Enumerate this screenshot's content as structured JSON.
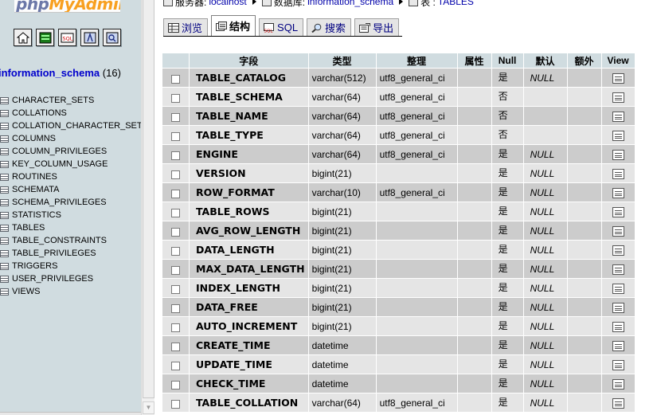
{
  "nav": {
    "logo_part1": "php",
    "logo_part2": "MyAdmin",
    "icons": [
      "home-icon",
      "sql-window-icon",
      "sql-query-icon",
      "help-icon",
      "docs-icon"
    ],
    "database": {
      "name": "information_schema",
      "count": "(16)"
    },
    "tables": [
      "CHARACTER_SETS",
      "COLLATIONS",
      "COLLATION_CHARACTER_SET_A",
      "COLUMNS",
      "COLUMN_PRIVILEGES",
      "KEY_COLUMN_USAGE",
      "ROUTINES",
      "SCHEMATA",
      "SCHEMA_PRIVILEGES",
      "STATISTICS",
      "TABLES",
      "TABLE_CONSTRAINTS",
      "TABLE_PRIVILEGES",
      "TRIGGERS",
      "USER_PRIVILEGES",
      "VIEWS"
    ]
  },
  "breadcrumb": {
    "server_label": "服务器:",
    "server": "localhost",
    "db_label": "数据库:",
    "db": "information_schema",
    "table_label": "表 :",
    "table": "TABLES"
  },
  "tabs": [
    {
      "label": "浏览",
      "icon": "browse-icon",
      "active": false
    },
    {
      "label": "结构",
      "icon": "structure-icon",
      "active": true
    },
    {
      "label": "SQL",
      "icon": "sql-icon",
      "active": false
    },
    {
      "label": "搜索",
      "icon": "search-icon",
      "active": false
    },
    {
      "label": "导出",
      "icon": "export-icon",
      "active": false
    }
  ],
  "columns": {
    "field": "字段",
    "type": "类型",
    "collation": "整理",
    "attributes": "属性",
    "null": "Null",
    "default": "默认",
    "extra": "额外",
    "view": "View"
  },
  "rows": [
    {
      "field": "TABLE_CATALOG",
      "type": "varchar(512)",
      "collation": "utf8_general_ci",
      "null": "是",
      "default": "NULL"
    },
    {
      "field": "TABLE_SCHEMA",
      "type": "varchar(64)",
      "collation": "utf8_general_ci",
      "null": "否",
      "default": ""
    },
    {
      "field": "TABLE_NAME",
      "type": "varchar(64)",
      "collation": "utf8_general_ci",
      "null": "否",
      "default": ""
    },
    {
      "field": "TABLE_TYPE",
      "type": "varchar(64)",
      "collation": "utf8_general_ci",
      "null": "否",
      "default": ""
    },
    {
      "field": "ENGINE",
      "type": "varchar(64)",
      "collation": "utf8_general_ci",
      "null": "是",
      "default": "NULL"
    },
    {
      "field": "VERSION",
      "type": "bigint(21)",
      "collation": "",
      "null": "是",
      "default": "NULL"
    },
    {
      "field": "ROW_FORMAT",
      "type": "varchar(10)",
      "collation": "utf8_general_ci",
      "null": "是",
      "default": "NULL"
    },
    {
      "field": "TABLE_ROWS",
      "type": "bigint(21)",
      "collation": "",
      "null": "是",
      "default": "NULL"
    },
    {
      "field": "AVG_ROW_LENGTH",
      "type": "bigint(21)",
      "collation": "",
      "null": "是",
      "default": "NULL"
    },
    {
      "field": "DATA_LENGTH",
      "type": "bigint(21)",
      "collation": "",
      "null": "是",
      "default": "NULL"
    },
    {
      "field": "MAX_DATA_LENGTH",
      "type": "bigint(21)",
      "collation": "",
      "null": "是",
      "default": "NULL"
    },
    {
      "field": "INDEX_LENGTH",
      "type": "bigint(21)",
      "collation": "",
      "null": "是",
      "default": "NULL"
    },
    {
      "field": "DATA_FREE",
      "type": "bigint(21)",
      "collation": "",
      "null": "是",
      "default": "NULL"
    },
    {
      "field": "AUTO_INCREMENT",
      "type": "bigint(21)",
      "collation": "",
      "null": "是",
      "default": "NULL"
    },
    {
      "field": "CREATE_TIME",
      "type": "datetime",
      "collation": "",
      "null": "是",
      "default": "NULL"
    },
    {
      "field": "UPDATE_TIME",
      "type": "datetime",
      "collation": "",
      "null": "是",
      "default": "NULL"
    },
    {
      "field": "CHECK_TIME",
      "type": "datetime",
      "collation": "",
      "null": "是",
      "default": "NULL"
    },
    {
      "field": "TABLE_COLLATION",
      "type": "varchar(64)",
      "collation": "utf8_general_ci",
      "null": "是",
      "default": "NULL"
    }
  ]
}
